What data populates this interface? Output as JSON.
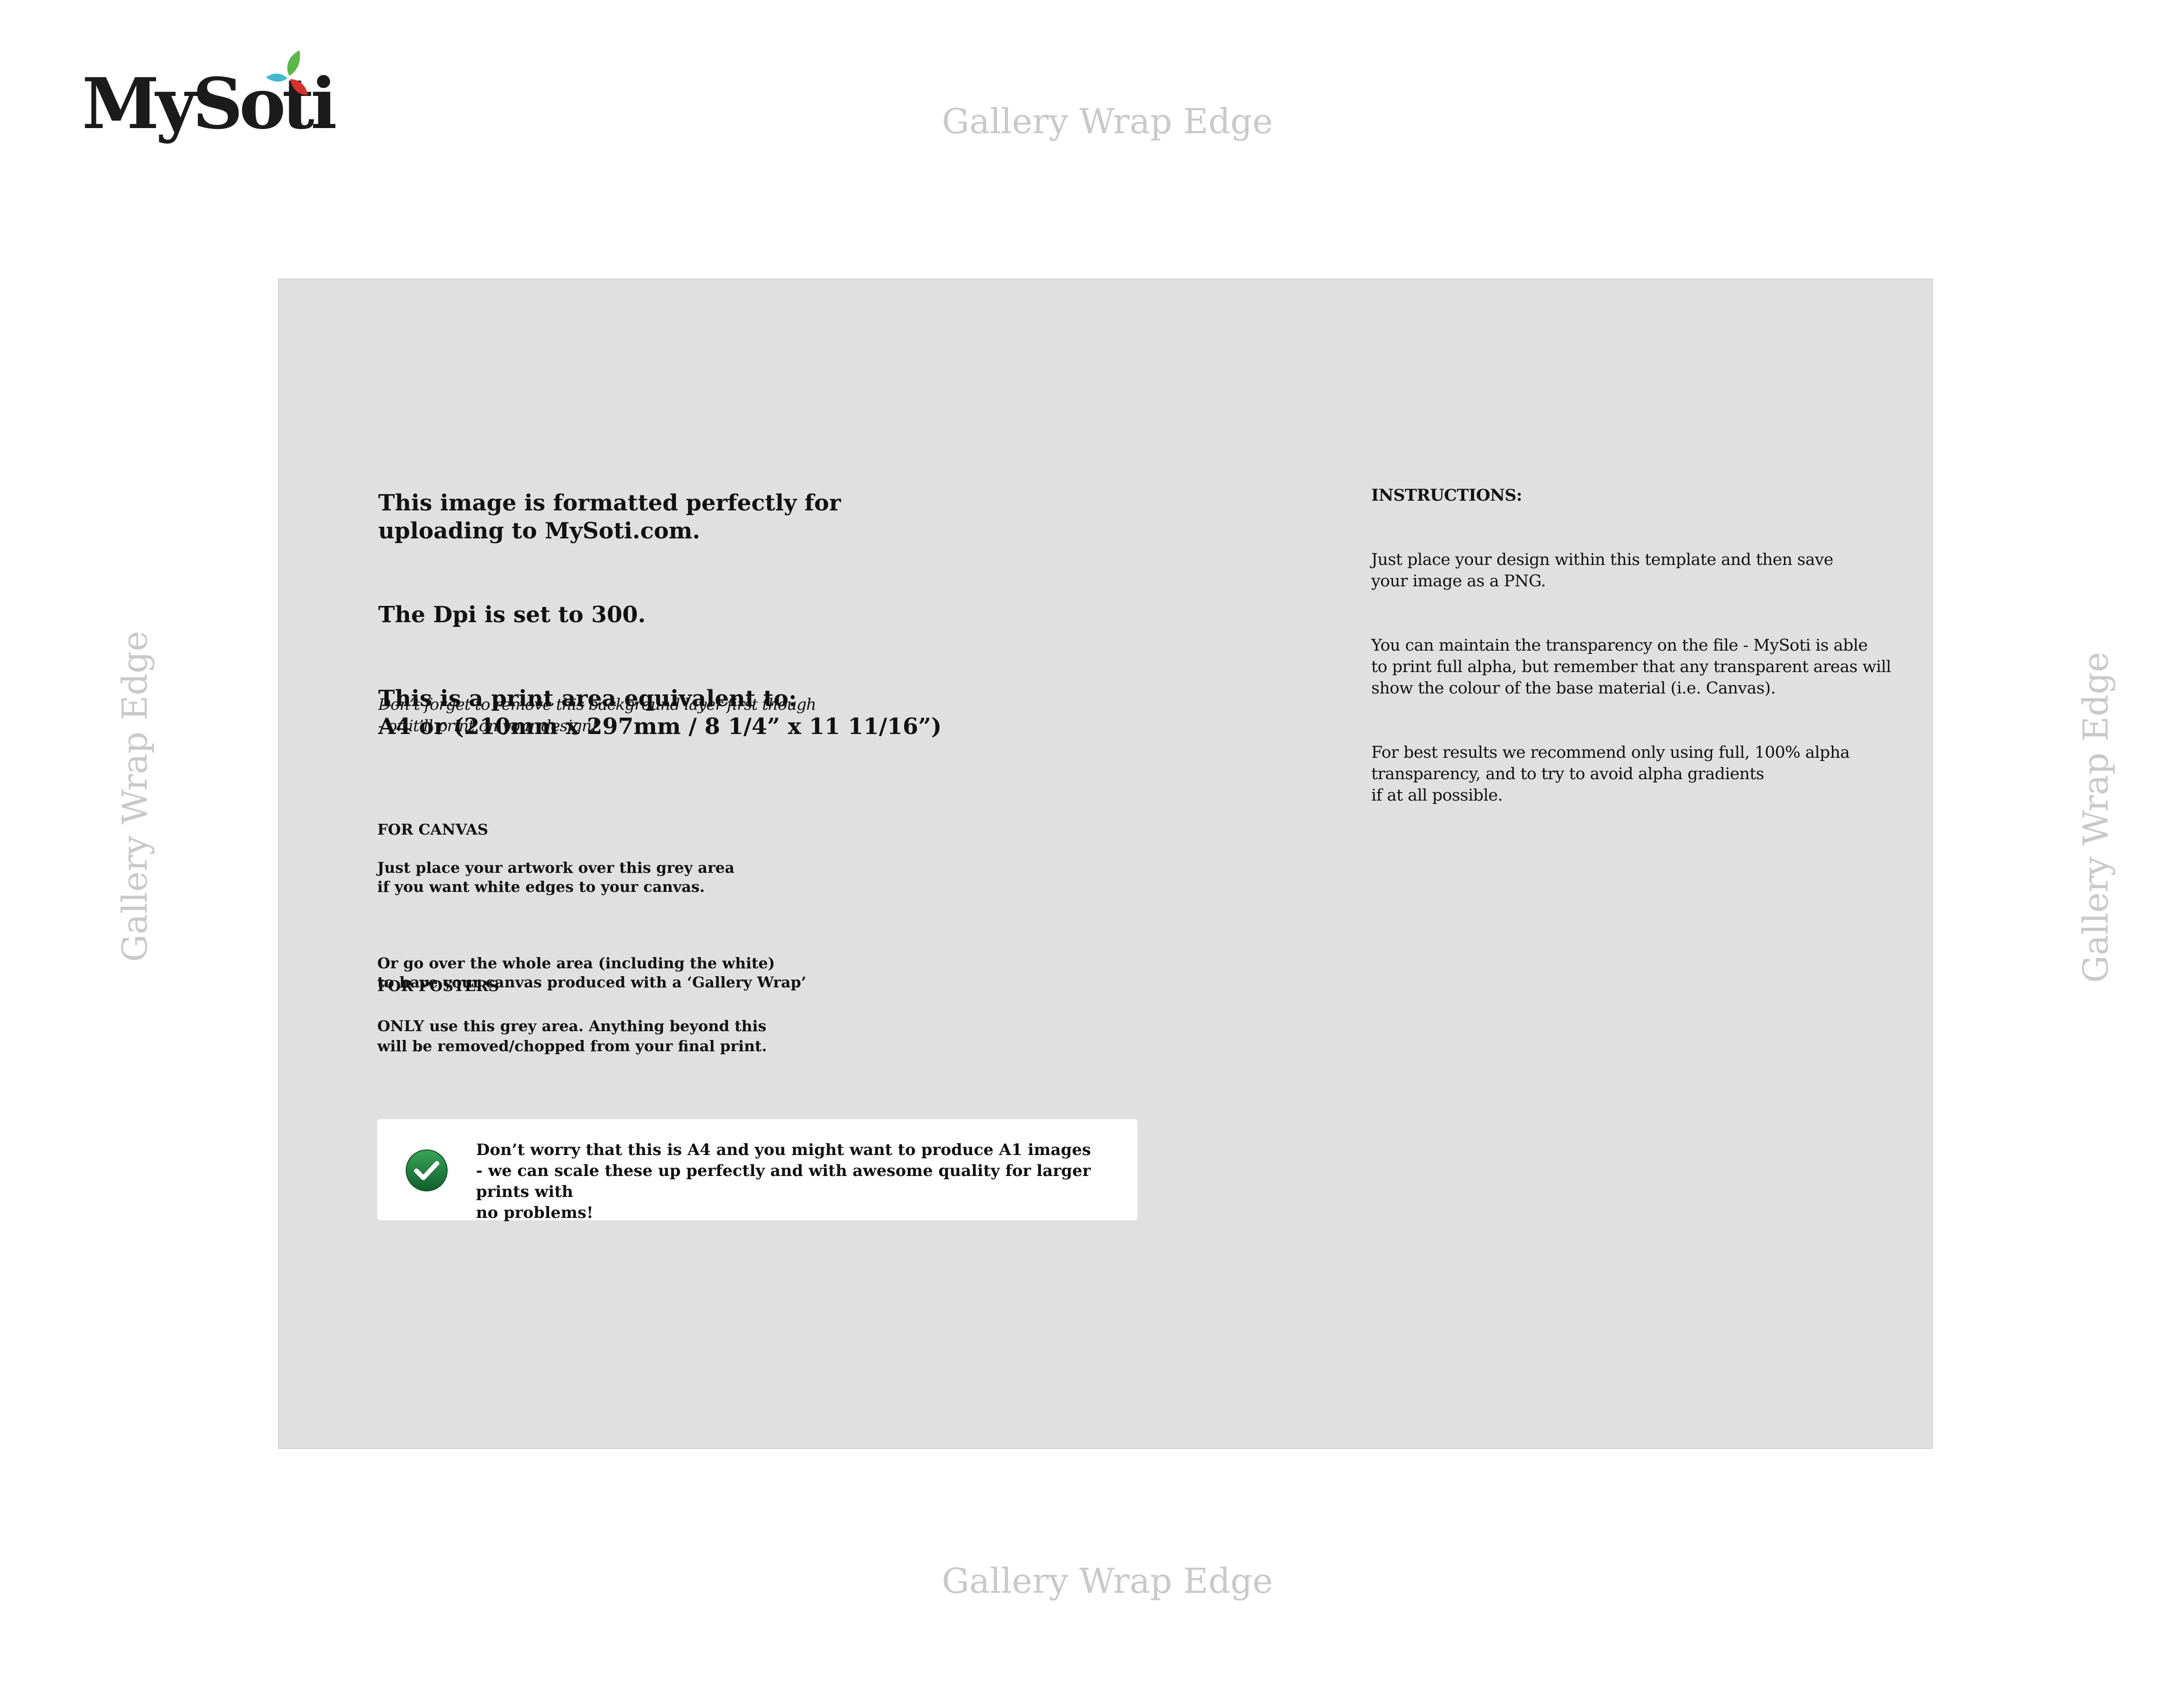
{
  "logo": {
    "text": "MySoti",
    "leaf_colors": [
      "#5db64a",
      "#45b8d0",
      "#d8322e"
    ]
  },
  "edges": {
    "top": "Gallery Wrap Edge",
    "bottom": "Gallery Wrap Edge",
    "left": "Gallery Wrap Edge",
    "right": "Gallery Wrap Edge"
  },
  "print_area": {
    "background": "#e0e0e0",
    "main": {
      "line1": "This image is formatted perfectly for\nuploading to MySoti.com.",
      "line2": "The Dpi is set to 300.",
      "line3": "This is a print area equivalent to:\nA4 or (210mm x 297mm / 8 1/4” x 11 11/16”)"
    },
    "reminder": "Don’t forget to remove this background layer first though\n- or it’ll print on your design!",
    "canvas": {
      "heading": "FOR CANVAS",
      "text1": "Just place your artwork over this grey area\nif you want white edges to your canvas.",
      "text2": "Or go over the whole area (including the white)\nto have your canvas produced with a ‘Gallery Wrap’"
    },
    "posters": {
      "heading": "FOR POSTERS",
      "text": "ONLY use this grey area. Anything beyond this\nwill be removed/chopped from your final print."
    },
    "instructions": {
      "title": "INSTRUCTIONS:",
      "para1": "Just place your design within this template and then save\nyour image as a PNG.",
      "para2": "You can maintain the transparency on the file - MySoti is able\nto print full alpha, but remember that any transparent areas will\nshow the colour of  the base material (i.e. Canvas).",
      "para3": "For best results we recommend only using full, 100% alpha\ntransparency, and to try to avoid alpha gradients\nif at all possible."
    },
    "notice": {
      "icon": "check-circle-icon",
      "icon_color": "#1e7a3a",
      "text": "Don’t worry that this is A4 and you might want to produce A1 images\n- we can scale these up perfectly and with awesome quality for larger prints with\nno problems!"
    }
  }
}
